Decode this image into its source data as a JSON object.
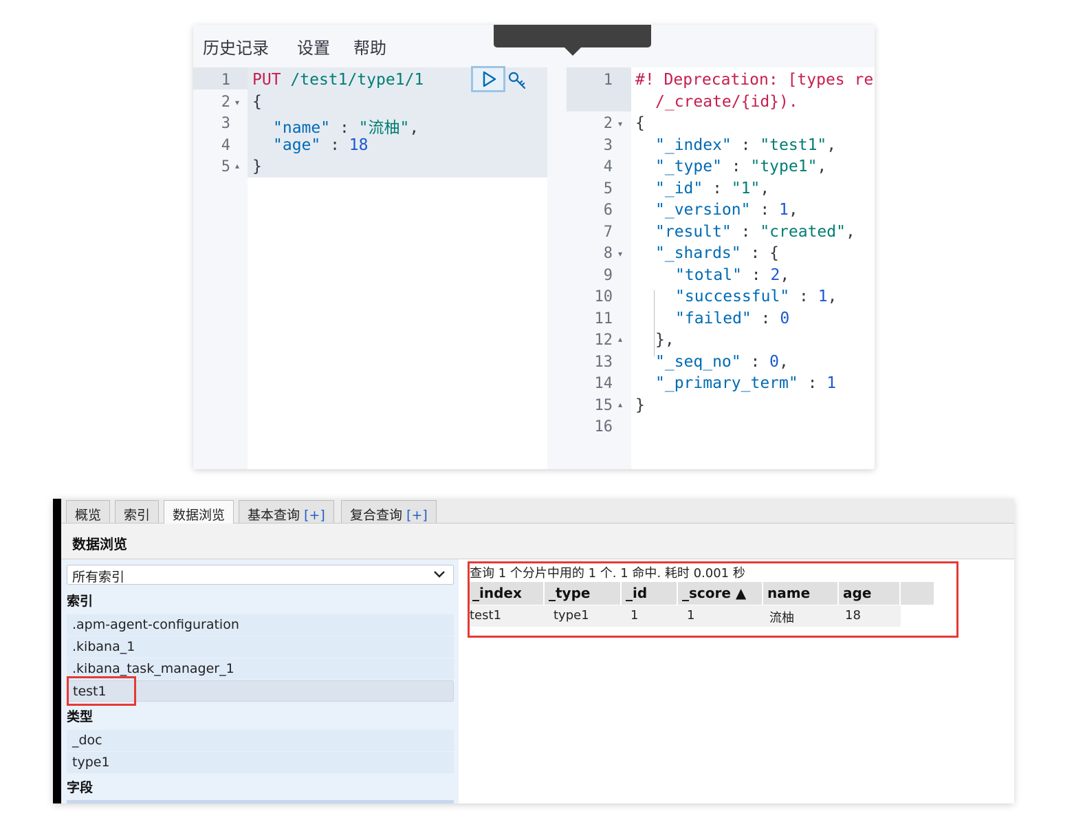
{
  "console": {
    "menu": [
      "历史记录",
      "设置",
      "帮助"
    ],
    "request_lines": [
      {
        "n": "1",
        "text": "PUT /test1/type1/1"
      },
      {
        "n": "2",
        "text": "{"
      },
      {
        "n": "3",
        "text": "  \"name\" : \"流柚\","
      },
      {
        "n": "4",
        "text": "  \"age\" : 18"
      },
      {
        "n": "5",
        "text": "}"
      }
    ],
    "request": {
      "method": "PUT",
      "path": "/test1/type1/1",
      "open_brace": "{",
      "name_key": "\"name\"",
      "name_value": "\"流柚\"",
      "age_key": "\"age\"",
      "age_value": "18",
      "close_brace": "}"
    },
    "response_line_numbers": [
      "1",
      "2",
      "3",
      "4",
      "5",
      "6",
      "7",
      "8",
      "9",
      "10",
      "11",
      "12",
      "13",
      "14",
      "15",
      "16"
    ],
    "response": {
      "deprecation_1": "#! Deprecation: [types re",
      "deprecation_2": "/_create/{id}).",
      "open": "{",
      "index_key": "\"_index\"",
      "index_val": "\"test1\"",
      "type_key": "\"_type\"",
      "type_val": "\"type1\"",
      "id_key": "\"_id\"",
      "id_val": "\"1\"",
      "version_key": "\"_version\"",
      "version_val": "1",
      "result_key": "\"result\"",
      "result_val": "\"created\"",
      "shards_key": "\"_shards\"",
      "shards_open": "{",
      "total_key": "\"total\"",
      "total_val": "2",
      "successful_key": "\"successful\"",
      "successful_val": "1",
      "failed_key": "\"failed\"",
      "failed_val": "0",
      "shards_close": "},",
      "seq_key": "\"_seq_no\"",
      "seq_val": "0",
      "term_key": "\"_primary_term\"",
      "term_val": "1",
      "close": "}"
    }
  },
  "head": {
    "tabs": [
      {
        "label": "概览"
      },
      {
        "label": "索引"
      },
      {
        "label": "数据浏览"
      },
      {
        "label": "基本查询",
        "plus": "[+]"
      },
      {
        "label": "复合查询",
        "plus": "[+]"
      }
    ],
    "page_title": "数据浏览",
    "index_select": "所有索引",
    "sections": {
      "indices": "索引",
      "types": "类型",
      "fields": "字段"
    },
    "indices": [
      ".apm-agent-configuration",
      ".kibana_1",
      ".kibana_task_manager_1",
      "test1"
    ],
    "types": [
      "_doc",
      "type1"
    ],
    "summary": "查询 1 个分片中用的 1 个. 1 命中. 耗时 0.001 秒",
    "columns": [
      "_index",
      "_type",
      "_id",
      "_score ▲",
      "name",
      "age"
    ],
    "rows": [
      [
        "test1",
        "type1",
        "1",
        "1",
        "流柚",
        "18"
      ]
    ]
  }
}
